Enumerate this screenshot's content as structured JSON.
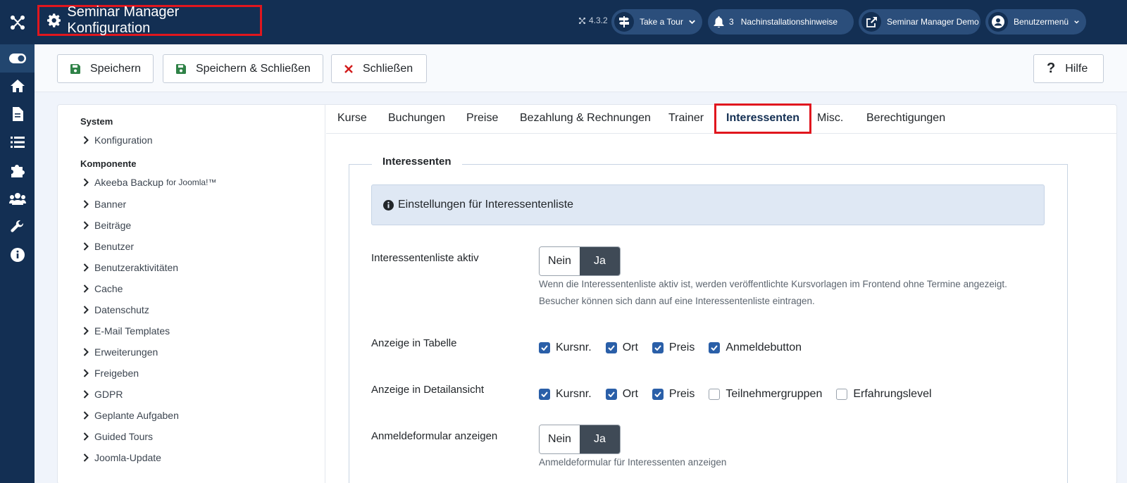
{
  "header": {
    "title": "Seminar Manager Konfiguration",
    "version": "4.3.2",
    "tour_label": "Take a Tour",
    "notifications_count": "3",
    "notifications_label": "Nachinstallationshinweise",
    "site_link_label": "Seminar Manager Demo",
    "user_menu_label": "Benutzermenü"
  },
  "sidebar": {
    "icons": [
      "toggle-icon",
      "home-icon",
      "file-icon",
      "list-icon",
      "puzzle-icon",
      "users-icon",
      "wrench-icon",
      "info-icon"
    ]
  },
  "toolbar": {
    "save_label": "Speichern",
    "save_close_label": "Speichern & Schließen",
    "close_label": "Schließen",
    "help_label": "Hilfe"
  },
  "nav": {
    "system_heading": "System",
    "system_items": [
      "Konfiguration"
    ],
    "component_heading": "Komponente",
    "akeeba_main": "Akeeba Backup",
    "akeeba_suffix": "for Joomla!™",
    "component_items": [
      "Banner",
      "Beiträge",
      "Benutzer",
      "Benutzeraktivitäten",
      "Cache",
      "Datenschutz",
      "E-Mail Templates",
      "Erweiterungen",
      "Freigeben",
      "GDPR",
      "Geplante Aufgaben",
      "Guided Tours",
      "Joomla-Update"
    ]
  },
  "tabs": [
    "Kurse",
    "Buchungen",
    "Preise",
    "Bezahlung & Rechnungen",
    "Trainer",
    "Interessenten",
    "Misc.",
    "Berechtigungen"
  ],
  "active_tab": "Interessenten",
  "form": {
    "legend": "Interessenten",
    "alert_text": "Einstellungen für Interessentenliste",
    "list_active": {
      "label": "Interessentenliste aktiv",
      "no": "Nein",
      "yes": "Ja",
      "value": "Ja",
      "help_line1": "Wenn die Interessentenliste aktiv ist, werden veröffentlichte Kursvorlagen im Frontend ohne Termine angezeigt.",
      "help_line2": "Besucher können sich dann auf eine Interessentenliste eintragen."
    },
    "table_display": {
      "label": "Anzeige in Tabelle",
      "options": [
        {
          "label": "Kursnr.",
          "checked": true
        },
        {
          "label": "Ort",
          "checked": true
        },
        {
          "label": "Preis",
          "checked": true
        },
        {
          "label": "Anmeldebutton",
          "checked": true
        }
      ]
    },
    "detail_display": {
      "label": "Anzeige in Detailansicht",
      "options": [
        {
          "label": "Kursnr.",
          "checked": true
        },
        {
          "label": "Ort",
          "checked": true
        },
        {
          "label": "Preis",
          "checked": true
        },
        {
          "label": "Teilnehmergruppen",
          "checked": false
        },
        {
          "label": "Erfahrungslevel",
          "checked": false
        }
      ]
    },
    "show_form": {
      "label": "Anmeldeformular anzeigen",
      "no": "Nein",
      "yes": "Ja",
      "value": "Ja",
      "help": "Anmeldeformular für Interessenten anzeigen"
    }
  },
  "colors": {
    "header_bg": "#132f53",
    "highlight": "#e0161e",
    "checkbox": "#2a5fa8",
    "switch_active": "#3f4a56"
  }
}
